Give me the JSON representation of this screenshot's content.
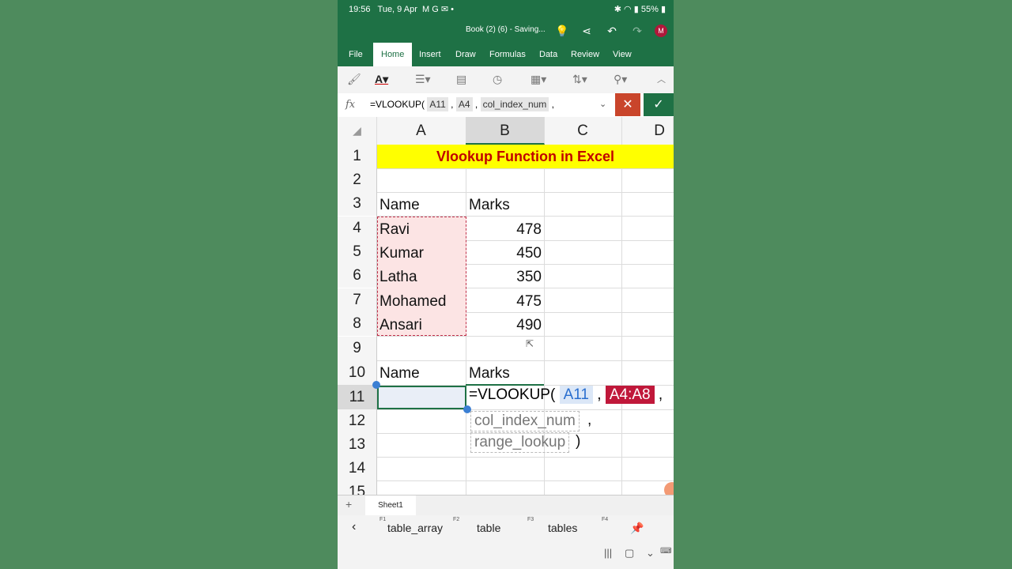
{
  "status": {
    "time": "19:56",
    "date": "Tue, 9 Apr",
    "notif": "M G ✉ •",
    "battery": "55%"
  },
  "doc_title": "Book (2) (6) - Saving...",
  "avatar": "M",
  "tabs": [
    "File",
    "Home",
    "Insert",
    "Draw",
    "Formulas",
    "Data",
    "Review",
    "View"
  ],
  "active_tab": "Home",
  "formula_bar": {
    "fx": "fx",
    "prefix": "=VLOOKUP(",
    "arg1": "A11",
    "arg2": "A4",
    "arg3": "col_index_num",
    "trail": ","
  },
  "columns": [
    "A",
    "B",
    "C",
    "D"
  ],
  "rows": [
    "1",
    "2",
    "3",
    "4",
    "5",
    "6",
    "7",
    "8",
    "9",
    "10",
    "11",
    "12",
    "13",
    "14",
    "15"
  ],
  "banner": "Vlookup Function in Excel",
  "table": {
    "header_name": "Name",
    "header_marks": "Marks",
    "names": [
      "Ravi",
      "Kumar",
      "Latha",
      "Mohamed",
      "Ansari"
    ],
    "marks": [
      "478",
      "450",
      "350",
      "475",
      "490"
    ]
  },
  "lookup": {
    "header_name": "Name",
    "header_marks": "Marks"
  },
  "in_cell": {
    "prefix": "=VLOOKUP(",
    "arg1": "A11",
    "arg2": "A4:A8",
    "arg3": "col_index_num",
    "arg4": "range_lookup",
    "close": ")"
  },
  "sheet": "Sheet1",
  "suggestions": [
    {
      "key": "F1",
      "label": "table_array"
    },
    {
      "key": "F2",
      "label": "table"
    },
    {
      "key": "F3",
      "label": "tables"
    },
    {
      "key": "F4",
      "label": ""
    }
  ]
}
